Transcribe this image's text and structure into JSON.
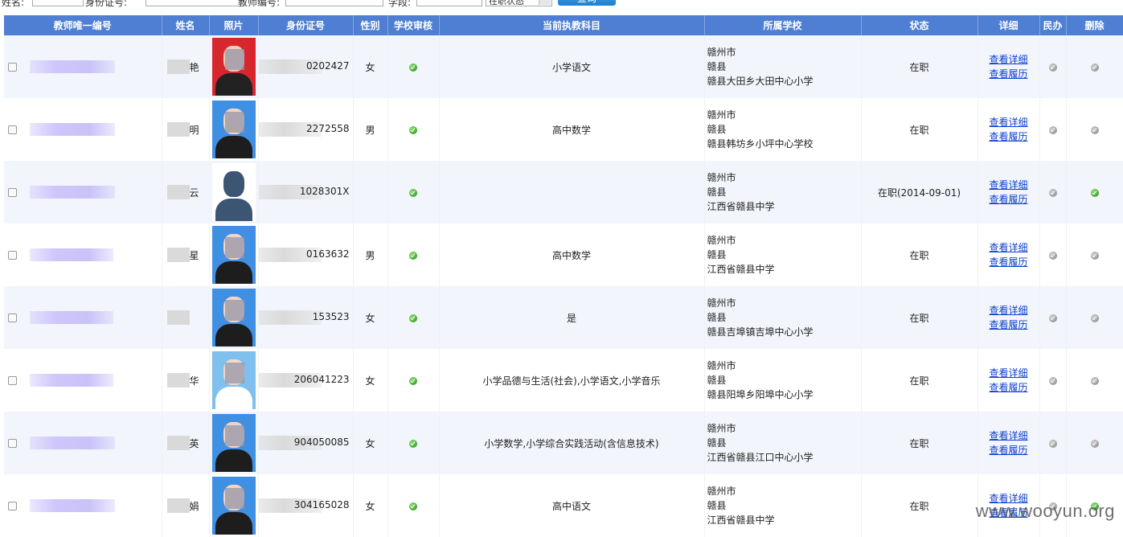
{
  "filter_bar": {
    "labels": [
      "姓名:",
      "身份证号:",
      "教师编号:",
      "学段:"
    ],
    "status_select": "在职状态",
    "query_button": "查询"
  },
  "columns": [
    "教师唯一编号",
    "姓名",
    "照片",
    "身份证号",
    "性别",
    "学校审核",
    "当前执教科目",
    "所属学校",
    "状态",
    "详细",
    "民办",
    "删除"
  ],
  "links": {
    "detail": "查看详细",
    "history": "查看履历"
  },
  "rows": [
    {
      "name_tail": "艳",
      "id_tail": "0202427",
      "gender": "女",
      "subject": "小学语文",
      "school": [
        "赣州市",
        "赣县",
        "赣县大田乡大田中心小学"
      ],
      "status": "在职",
      "delete_green": false,
      "photo": "red"
    },
    {
      "name_tail": "明",
      "id_tail": "2272558",
      "gender": "男",
      "subject": "高中数学",
      "school": [
        "赣州市",
        "赣县",
        "赣县韩坊乡小坪中心学校"
      ],
      "status": "在职",
      "delete_green": false,
      "photo": "blue"
    },
    {
      "name_tail": "云",
      "id_tail": "1028301X",
      "gender": "",
      "subject": "",
      "school": [
        "赣州市",
        "赣县",
        "江西省赣县中学"
      ],
      "status": "在职(2014-09-01)",
      "delete_green": true,
      "photo": "silhouette"
    },
    {
      "name_tail": "星",
      "id_tail": "0163632",
      "gender": "男",
      "subject": "高中数学",
      "school": [
        "赣州市",
        "赣县",
        "江西省赣县中学"
      ],
      "status": "在职",
      "delete_green": false,
      "photo": "blue"
    },
    {
      "name_tail": "",
      "id_tail": "153523",
      "gender": "女",
      "subject": "是",
      "school": [
        "赣州市",
        "赣县",
        "赣县吉埠镇吉埠中心小学"
      ],
      "status": "在职",
      "delete_green": false,
      "photo": "blue"
    },
    {
      "name_tail": "华",
      "id_tail": "206041223",
      "gender": "女",
      "subject": "小学品德与生活(社会),小学语文,小学音乐",
      "school": [
        "赣州市",
        "赣县",
        "赣县阳埠乡阳埠中心小学"
      ],
      "status": "在职",
      "delete_green": false,
      "photo": "lightblue"
    },
    {
      "name_tail": "英",
      "id_tail": "904050085",
      "gender": "女",
      "subject": "小学数学,小学综合实践活动(含信息技术)",
      "school": [
        "赣州市",
        "赣县",
        "江西省赣县江口中心小学"
      ],
      "status": "在职",
      "delete_green": false,
      "photo": "blue"
    },
    {
      "name_tail": "娟",
      "id_tail": "304165028",
      "gender": "女",
      "subject": "高中语文",
      "school": [
        "赣州市",
        "赣县",
        "江西省赣县中学"
      ],
      "status": "在职",
      "delete_green": true,
      "photo": "blue"
    }
  ],
  "watermark": "www.wooyun.org"
}
